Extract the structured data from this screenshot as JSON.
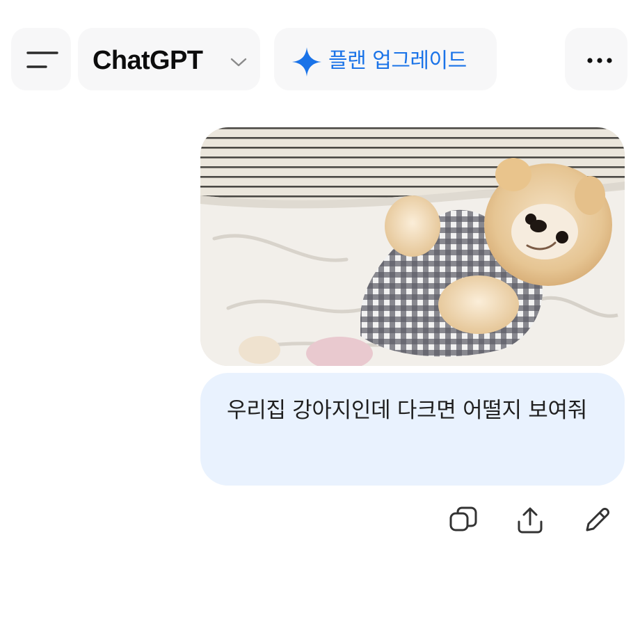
{
  "header": {
    "title": "ChatGPT",
    "upgrade_label": "플랜 업그레이드",
    "icons": {
      "menu": "menu-icon",
      "title_dropdown": "chevron-down-icon",
      "upgrade": "sparkle-icon",
      "more": "more-options-icon"
    }
  },
  "conversation": {
    "user_message": {
      "image": "photo-pomeranian-dog-in-gingham-shirt-on-bed",
      "text": "우리집 강아지인데 다크면 어떨지 보여줘"
    },
    "message_actions": [
      "copy-icon",
      "share-icon",
      "edit-icon"
    ]
  },
  "colors": {
    "background": "#ffffff",
    "header_pill": "#f7f7f8",
    "accent": "#1a73e8",
    "bubble": "#e9f2fe",
    "text": "#0d0d0d"
  }
}
